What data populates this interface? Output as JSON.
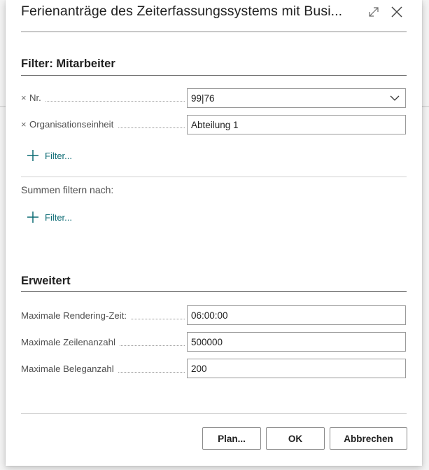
{
  "dialog": {
    "title": "Ferienanträge des Zeiterfassungssystems mit Busi..."
  },
  "filter_section": {
    "title": "Filter: Mitarbeiter",
    "fields": [
      {
        "label": "Nr.",
        "value": "99|76",
        "removable": true,
        "has_dropdown": true
      },
      {
        "label": "Organisationseinheit",
        "value": "Abteilung 1",
        "removable": true,
        "has_dropdown": false
      }
    ],
    "add_filter_label": "Filter..."
  },
  "totals_section": {
    "label": "Summen filtern nach:",
    "add_filter_label": "Filter..."
  },
  "advanced_section": {
    "title": "Erweitert",
    "fields": [
      {
        "label": "Maximale Rendering-Zeit:",
        "value": "06:00:00"
      },
      {
        "label": "Maximale Zeilenanzahl",
        "value": "500000"
      },
      {
        "label": "Maximale Beleganzahl",
        "value": "200"
      }
    ]
  },
  "buttons": {
    "plan": "Plan...",
    "ok": "OK",
    "cancel": "Abbrechen"
  },
  "icons": {
    "expand": "expand-icon",
    "close": "close-icon",
    "remove": "remove-filter-icon",
    "dropdown": "chevron-down-icon",
    "add": "plus-icon"
  },
  "colors": {
    "accent": "#0c6b74",
    "text": "#212121",
    "label": "#505050"
  }
}
